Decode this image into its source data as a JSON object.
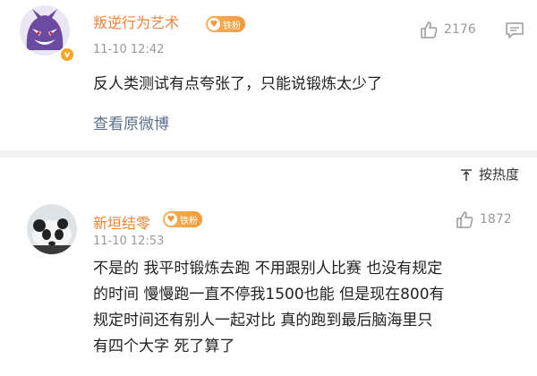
{
  "comments": [
    {
      "username": "叛逆行为艺术",
      "fan_badge": "铁粉",
      "time": "11-10 12:42",
      "likes": "2176",
      "text": "反人类测试有点夸张了，只能说锻炼太少了",
      "view_original": "查看原微博"
    },
    {
      "username": "新垣结零",
      "fan_badge": "铁粉",
      "time": "11-10 12:53",
      "likes": "1872",
      "text_lines": [
        "不是的 我平时锻炼去跑 不用跟别人比赛 也没有规定",
        "的时间 慢慢跑一直不停我1500也能 但是现在800有",
        "规定时间还有别人一起对比 真的跑到最后脑海里只",
        "有四个大字 死了算了"
      ]
    }
  ],
  "sort": {
    "label": "按热度"
  },
  "colors": {
    "username": "#e8833a",
    "link": "#5b6f8f",
    "badge": "#f29a3b"
  }
}
